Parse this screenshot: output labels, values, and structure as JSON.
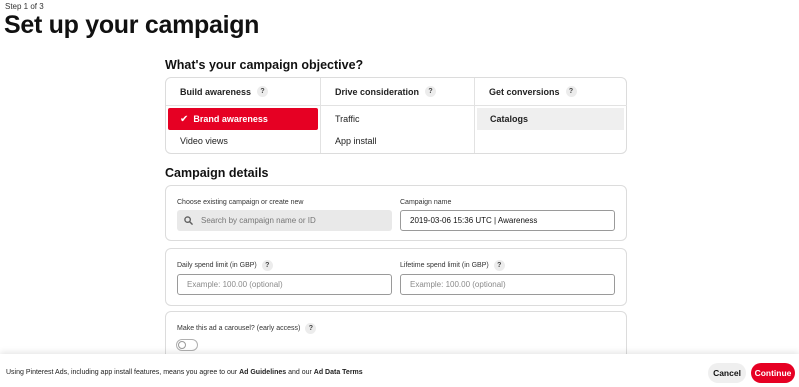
{
  "header": {
    "step": "Step 1 of 3",
    "title": "Set up your campaign"
  },
  "objective": {
    "title": "What's your campaign objective?",
    "help_glyph": "?",
    "columns": [
      {
        "label": "Build awareness",
        "items": [
          "Brand awareness",
          "Video views"
        ],
        "selected_index": 0
      },
      {
        "label": "Drive consideration",
        "items": [
          "Traffic",
          "App install"
        ]
      },
      {
        "label": "Get conversions",
        "items": [
          "Catalogs"
        ]
      }
    ]
  },
  "details": {
    "title": "Campaign details",
    "existing_label": "Choose existing campaign or create new",
    "search_placeholder": "Search by campaign name or ID",
    "name_label": "Campaign name",
    "name_value": "2019-03-06 15:36 UTC | Awareness",
    "daily_label": "Daily spend limit (in GBP)",
    "daily_placeholder": "Example: 100.00 (optional)",
    "lifetime_label": "Lifetime spend limit (in GBP)",
    "lifetime_placeholder": "Example: 100.00 (optional)",
    "carousel_label": "Make this ad a carousel? (early access)",
    "carousel_enabled": false
  },
  "footer": {
    "text_prefix": "Using Pinterest Ads, including app install features, means you agree to our ",
    "link_guidelines": "Ad Guidelines",
    "text_middle": " and our ",
    "link_terms": "Ad Data Terms",
    "cancel_label": "Cancel",
    "continue_label": "Continue"
  },
  "colors": {
    "accent": "#e60023",
    "selected_grey": "#efefef"
  }
}
